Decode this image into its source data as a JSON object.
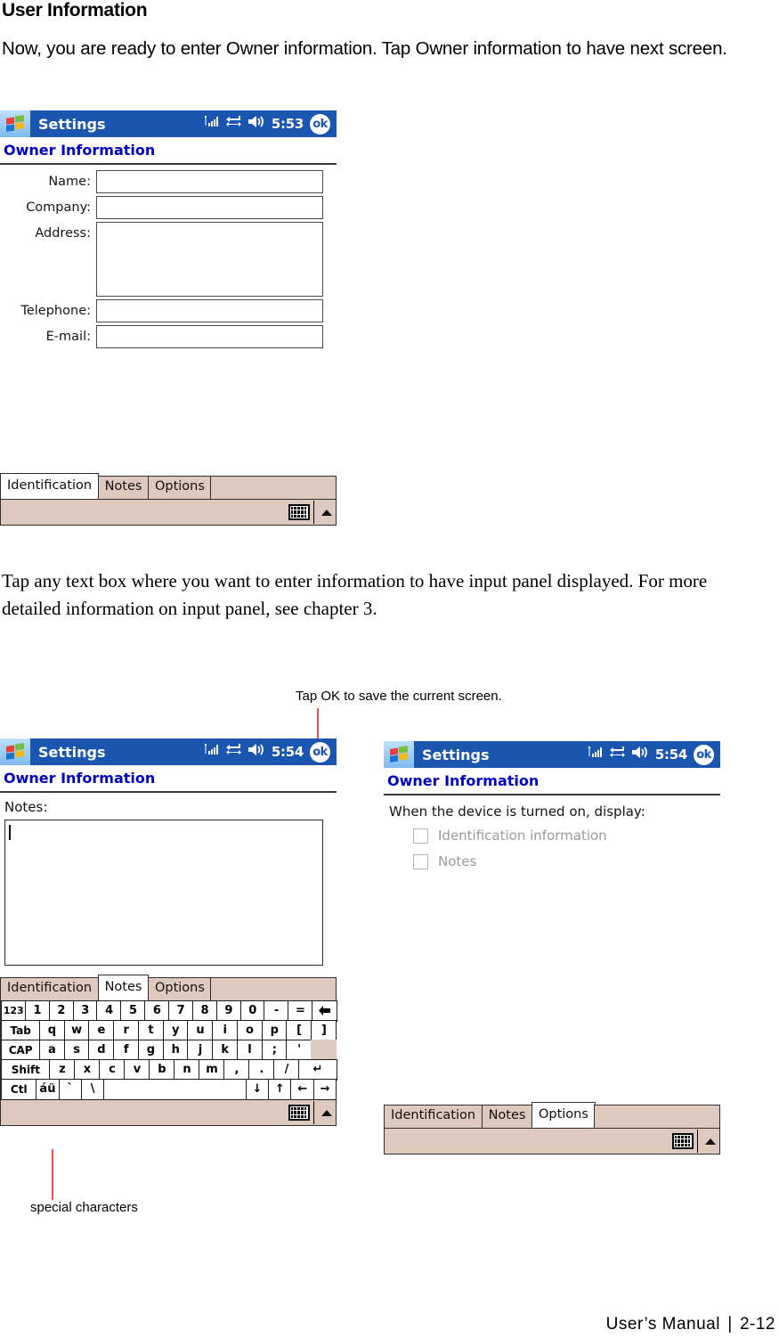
{
  "document": {
    "heading": "User Information",
    "intro_paragraph": "Now, you are ready to enter Owner information. Tap Owner information to have next screen.",
    "body_paragraph": "Tap any text box where you want to enter information to have input panel displayed. For more detailed information on input panel, see chapter 3.",
    "footer": {
      "manual_label": "User’s Manual",
      "separator": "∣",
      "page_number": "2-12"
    }
  },
  "callouts": {
    "tap_ok": "Tap OK to save the current screen.",
    "special_characters": "special characters"
  },
  "colors": {
    "titlebar_blue": "#1a56b0",
    "header_blue": "#0000c8",
    "tab_beige": "#dec9bf",
    "callout_red": "#e8372b",
    "disabled_gray": "#9b9b9b"
  },
  "screens": [
    {
      "id": "identification",
      "titlebar": {
        "app_title": "Settings",
        "time": "5:53",
        "ok_label": "ok",
        "icons": [
          "signal-icon",
          "connectivity-icon",
          "speaker-icon"
        ]
      },
      "page_header": "Owner Information",
      "fields": [
        {
          "label": "Name:",
          "value": "",
          "type": "single"
        },
        {
          "label": "Company:",
          "value": "",
          "type": "single"
        },
        {
          "label": "Address:",
          "value": "",
          "type": "multi"
        },
        {
          "label": "Telephone:",
          "value": "",
          "type": "single"
        },
        {
          "label": "E-mail:",
          "value": "",
          "type": "single"
        }
      ],
      "tabs": [
        {
          "label": "Identification",
          "active": true
        },
        {
          "label": "Notes",
          "active": false
        },
        {
          "label": "Options",
          "active": false
        }
      ],
      "softbar": {
        "keyboard_icon": "keyboard-icon",
        "expand_icon": "up-arrow-icon"
      }
    },
    {
      "id": "notes",
      "titlebar": {
        "app_title": "Settings",
        "time": "5:54",
        "ok_label": "ok",
        "icons": [
          "signal-icon",
          "connectivity-icon",
          "speaker-icon"
        ]
      },
      "page_header": "Owner Information",
      "notes_label": "Notes:",
      "notes_value": "",
      "tabs": [
        {
          "label": "Identification",
          "active": false
        },
        {
          "label": "Notes",
          "active": true
        },
        {
          "label": "Options",
          "active": false
        }
      ],
      "keyboard": {
        "rows": [
          [
            "123",
            "1",
            "2",
            "3",
            "4",
            "5",
            "6",
            "7",
            "8",
            "9",
            "0",
            "-",
            "=",
            "←"
          ],
          [
            "Tab",
            "q",
            "w",
            "e",
            "r",
            "t",
            "y",
            "u",
            "i",
            "o",
            "p",
            "[",
            "]"
          ],
          [
            "CAP",
            "a",
            "s",
            "d",
            "f",
            "g",
            "h",
            "j",
            "k",
            "l",
            ";",
            "'",
            ""
          ],
          [
            "Shift",
            "z",
            "x",
            "c",
            "v",
            "b",
            "n",
            "m",
            ",",
            ".",
            "/",
            "↵"
          ],
          [
            "Ctl",
            "áü",
            "`",
            "\\",
            "",
            "↓",
            "↑",
            "←",
            "→"
          ]
        ]
      },
      "softbar": {
        "keyboard_icon": "keyboard-icon",
        "expand_icon": "up-arrow-icon"
      }
    },
    {
      "id": "options",
      "titlebar": {
        "app_title": "Settings",
        "time": "5:54",
        "ok_label": "ok",
        "icons": [
          "signal-icon",
          "connectivity-icon",
          "speaker-icon"
        ]
      },
      "page_header": "Owner Information",
      "options_title": "When the device is turned on, display:",
      "options": [
        {
          "label": "Identification information",
          "checked": false,
          "disabled": true
        },
        {
          "label": "Notes",
          "checked": false,
          "disabled": true
        }
      ],
      "tabs": [
        {
          "label": "Identification",
          "active": false
        },
        {
          "label": "Notes",
          "active": false
        },
        {
          "label": "Options",
          "active": true
        }
      ],
      "softbar": {
        "keyboard_icon": "keyboard-icon",
        "expand_icon": "up-arrow-icon"
      }
    }
  ]
}
